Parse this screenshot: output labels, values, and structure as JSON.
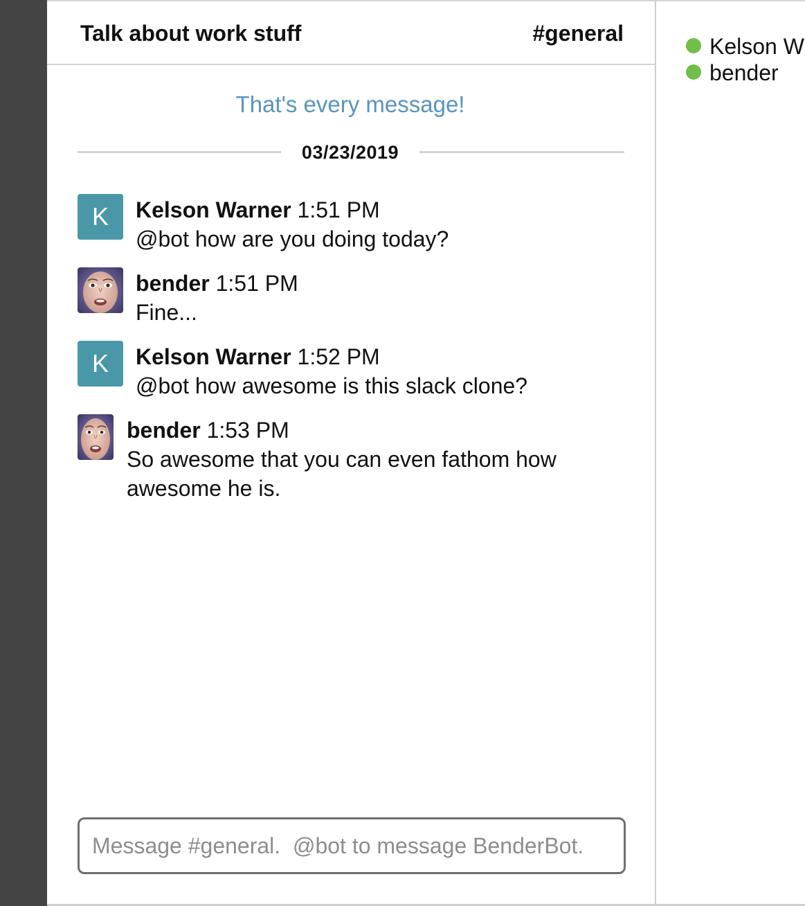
{
  "header": {
    "title": "Talk about work stuff",
    "channel": "#general"
  },
  "feed": {
    "all_loaded_notice": "That's every message!",
    "date_divider": "03/23/2019"
  },
  "messages": [
    {
      "author": "Kelson Warner",
      "time": "1:51 PM",
      "text": "@bot how are you doing today?",
      "avatar_letter": "K",
      "avatar_color": "#4a97a7"
    },
    {
      "author": "bender",
      "time": "1:51 PM",
      "text": "Fine...",
      "avatar": "face-photo"
    },
    {
      "author": "Kelson Warner",
      "time": "1:52 PM",
      "text": "@bot how awesome is this slack clone?",
      "avatar_letter": "K",
      "avatar_color": "#4a97a7"
    },
    {
      "author": "bender",
      "time": "1:53 PM",
      "text": "So awesome that you can even fathom how awesome he is.",
      "avatar": "face-photo"
    }
  ],
  "composer": {
    "placeholder": "Message #general.  @bot to message BenderBot.",
    "value": ""
  },
  "members": [
    {
      "name": "Kelson W",
      "status": "online"
    },
    {
      "name": "bender",
      "status": "online"
    }
  ],
  "colors": {
    "sidebar": "#444444",
    "accent_link": "#5894bd",
    "online": "#6fbf4a"
  }
}
